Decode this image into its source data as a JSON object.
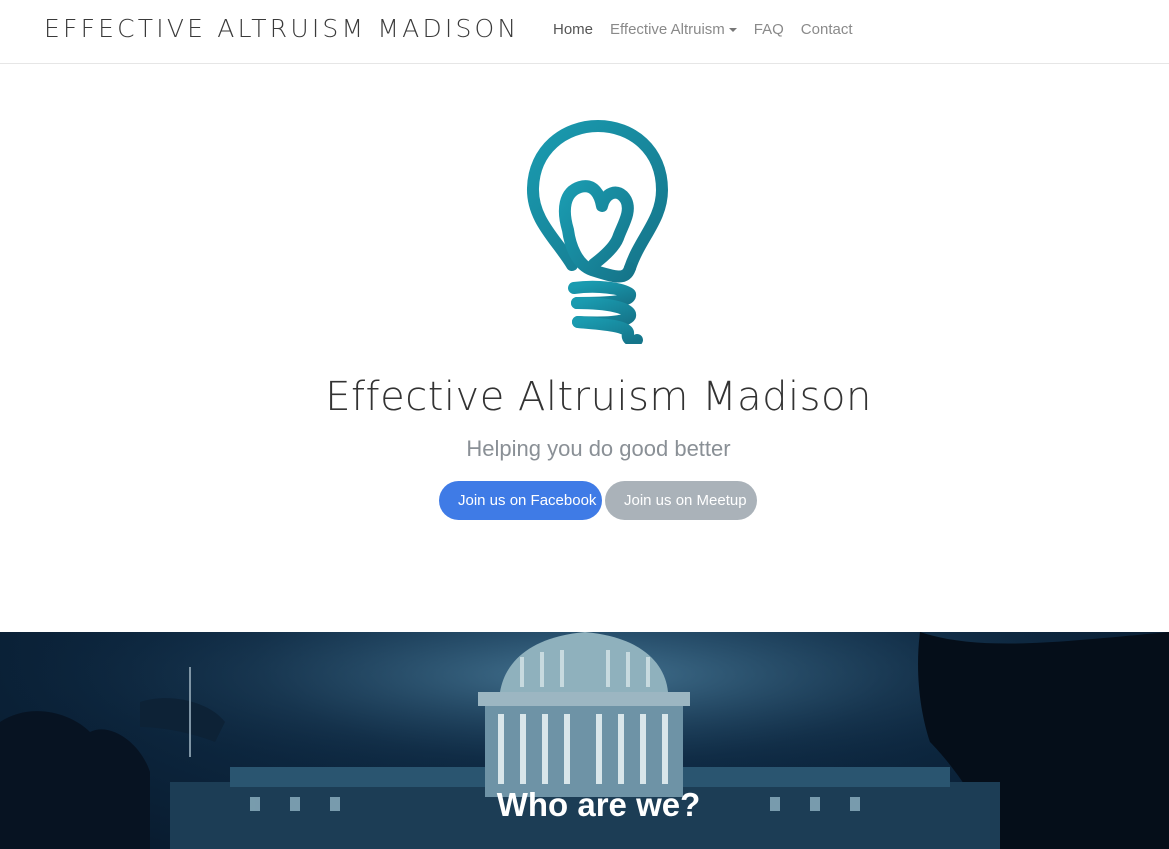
{
  "nav": {
    "brand": "EFFECTIVE ALTRUISM MADISON",
    "links": [
      {
        "label": "Home",
        "active": true
      },
      {
        "label": "Effective Altruism",
        "dropdown": true
      },
      {
        "label": "FAQ"
      },
      {
        "label": "Contact"
      }
    ]
  },
  "hero": {
    "logo_icon": "lightbulb-heart-icon",
    "title": "Effective Altruism Madison",
    "subtitle": "Helping you do good better",
    "buttons": {
      "facebook": "Join us on Facebook",
      "meetup": "Join us on Meetup"
    }
  },
  "about_section": {
    "heading": "Who are we?",
    "background_image": "capitol-building-night-image"
  },
  "colors": {
    "brand_teal": "#1f8fa5",
    "facebook_button": "#3f7be6",
    "meetup_button": "#aab2b9",
    "nav_text": "#8a8a8a"
  }
}
